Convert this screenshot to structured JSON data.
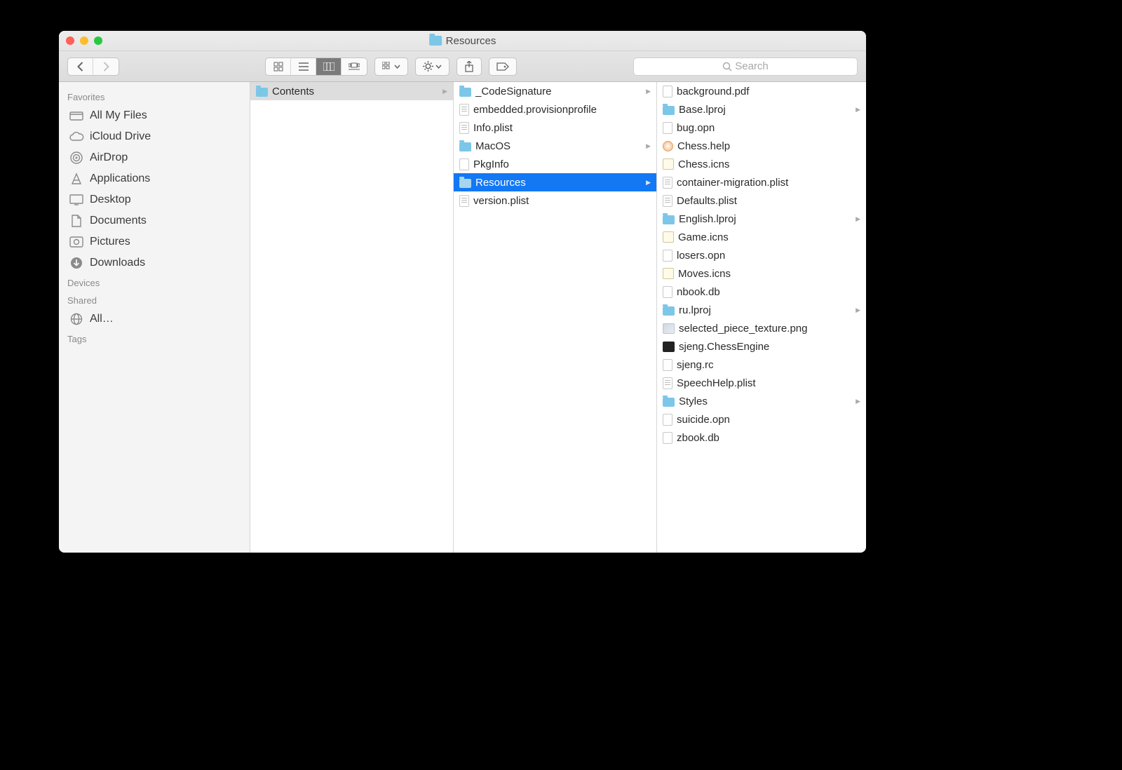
{
  "window": {
    "title": "Resources"
  },
  "toolbar": {
    "search_placeholder": "Search"
  },
  "sidebar": {
    "sections": [
      {
        "header": "Favorites",
        "items": [
          {
            "label": "All My Files",
            "icon": "all-files"
          },
          {
            "label": "iCloud Drive",
            "icon": "icloud"
          },
          {
            "label": "AirDrop",
            "icon": "airdrop"
          },
          {
            "label": "Applications",
            "icon": "applications"
          },
          {
            "label": "Desktop",
            "icon": "desktop"
          },
          {
            "label": "Documents",
            "icon": "documents"
          },
          {
            "label": "Pictures",
            "icon": "pictures"
          },
          {
            "label": "Downloads",
            "icon": "downloads"
          }
        ]
      },
      {
        "header": "Devices",
        "items": []
      },
      {
        "header": "Shared",
        "items": [
          {
            "label": "All…",
            "icon": "network"
          }
        ]
      },
      {
        "header": "Tags",
        "items": []
      }
    ]
  },
  "columns": [
    {
      "items": [
        {
          "label": "Contents",
          "type": "folder",
          "selected": "gray",
          "hasChildren": true
        }
      ]
    },
    {
      "items": [
        {
          "label": "_CodeSignature",
          "type": "folder",
          "hasChildren": true
        },
        {
          "label": "embedded.provisionprofile",
          "type": "plist"
        },
        {
          "label": "Info.plist",
          "type": "plist"
        },
        {
          "label": "MacOS",
          "type": "folder",
          "hasChildren": true
        },
        {
          "label": "PkgInfo",
          "type": "doc"
        },
        {
          "label": "Resources",
          "type": "folder",
          "selected": "blue",
          "hasChildren": true
        },
        {
          "label": "version.plist",
          "type": "plist"
        }
      ]
    },
    {
      "items": [
        {
          "label": "background.pdf",
          "type": "doc"
        },
        {
          "label": "Base.lproj",
          "type": "folder",
          "hasChildren": true
        },
        {
          "label": "bug.opn",
          "type": "doc"
        },
        {
          "label": "Chess.help",
          "type": "help"
        },
        {
          "label": "Chess.icns",
          "type": "icns"
        },
        {
          "label": "container-migration.plist",
          "type": "plist"
        },
        {
          "label": "Defaults.plist",
          "type": "plist"
        },
        {
          "label": "English.lproj",
          "type": "folder",
          "hasChildren": true
        },
        {
          "label": "Game.icns",
          "type": "icns"
        },
        {
          "label": "losers.opn",
          "type": "doc"
        },
        {
          "label": "Moves.icns",
          "type": "icns"
        },
        {
          "label": "nbook.db",
          "type": "doc"
        },
        {
          "label": "ru.lproj",
          "type": "folder",
          "hasChildren": true
        },
        {
          "label": "selected_piece_texture.png",
          "type": "png"
        },
        {
          "label": "sjeng.ChessEngine",
          "type": "exec"
        },
        {
          "label": "sjeng.rc",
          "type": "doc"
        },
        {
          "label": "SpeechHelp.plist",
          "type": "plist"
        },
        {
          "label": "Styles",
          "type": "folder",
          "hasChildren": true
        },
        {
          "label": "suicide.opn",
          "type": "doc"
        },
        {
          "label": "zbook.db",
          "type": "doc"
        }
      ]
    }
  ]
}
